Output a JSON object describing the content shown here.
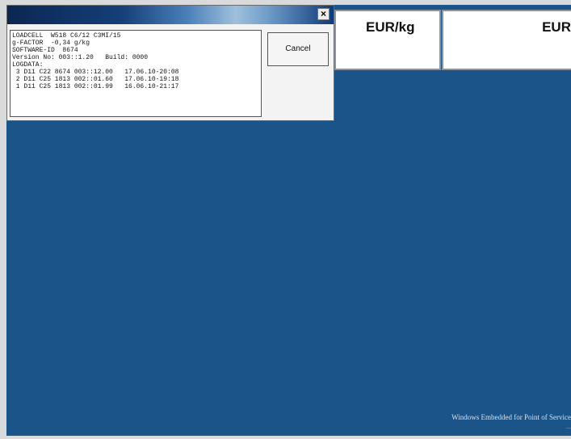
{
  "price_headers": [
    "EUR/kg",
    "EUR"
  ],
  "dialog": {
    "close_glyph": "×",
    "cancel_label": "Cancel",
    "info_lines": [
      "LOADCELL  W518 C6/12 C3MI/15",
      "g-FACTOR  -0,34 g/kg",
      "SOFTWARE-ID  8674",
      "Version No: 003::1.20   Build: 0000",
      "LOGDATA:",
      " 3 D11 C22 8674 003::12.00   17.06.10-20:08",
      " 2 D11 C25 1813 002::01.60   17.06.10-19:18",
      " 1 D11 C25 1813 002::01.99   16.06.10-21:17"
    ]
  },
  "footer": {
    "line1": "Windows Embedded for Point of Service",
    "line2": "..."
  },
  "colors": {
    "desktop": "#1b5488",
    "titlebar_dark": "#0b2753"
  }
}
